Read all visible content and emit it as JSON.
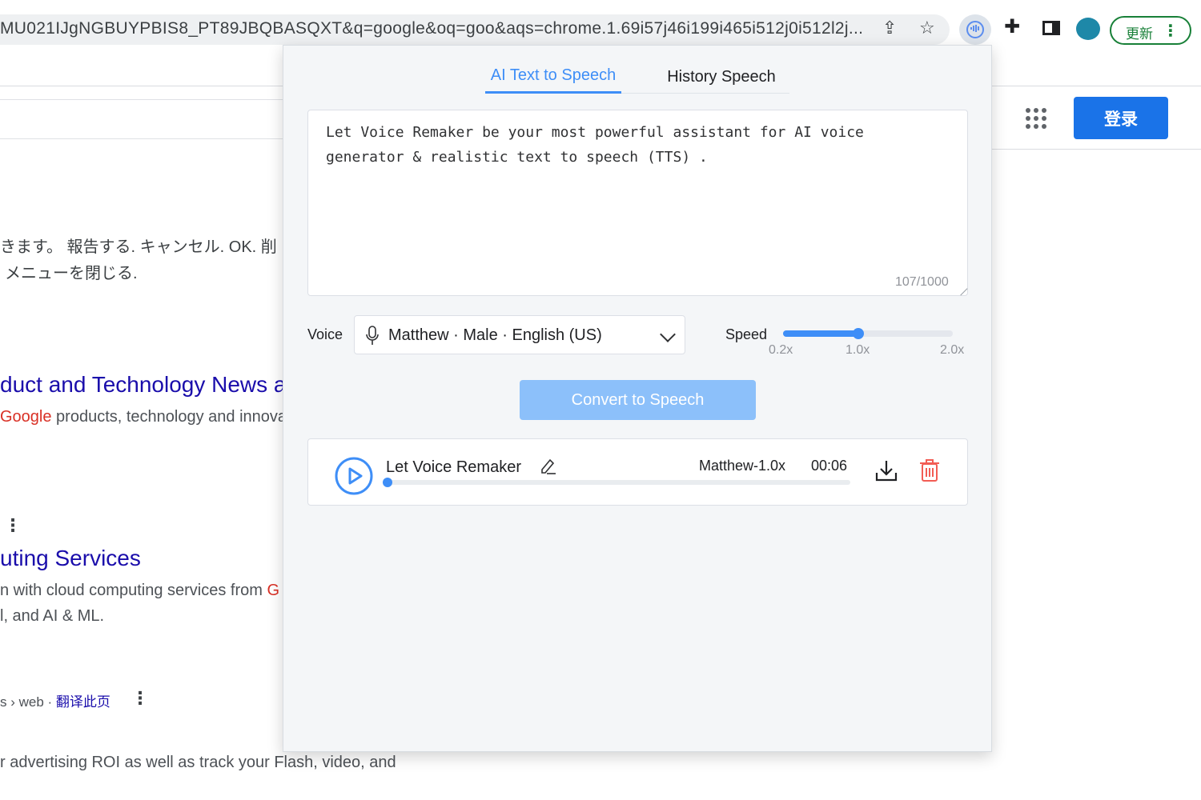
{
  "browser": {
    "url": "MU021IJgNGBUYPBIS8_PT89JBQBASQXT&q=google&oq=goo&aqs=chrome.1.69i57j46i199i465i512j0i512l2j...",
    "update_label": "更新",
    "icons": [
      "share-icon",
      "star-icon",
      "voice-remaker-extension-icon",
      "puzzle-icon",
      "side-panel-icon",
      "profile-avatar",
      "more-vert-icon"
    ]
  },
  "google_page": {
    "login_label": "登录",
    "snippet_ja_1": "きます。 報告する. キャンセル. OK. 削",
    "snippet_ja_2": "メニューを閉じる.",
    "result1_title": "duct and Technology News a",
    "result1_snippet_prefix": "Google",
    "result1_snippet_rest": " products, technology and innova",
    "result2_title": "uting Services",
    "result2_snippet_1_rest": "n with cloud computing services from ",
    "result2_snippet_1_red": "G",
    "result2_snippet_2": "l, and AI & ML.",
    "result3_breadcrumb": "s › web · ",
    "result3_translate": "翻译此页",
    "result3_snippet": "r advertising ROI as well as track your Flash, video, and"
  },
  "popup": {
    "tabs": [
      {
        "label": "AI Text to Speech",
        "active": true
      },
      {
        "label": "History Speech",
        "active": false
      }
    ],
    "text_input": "Let Voice Remaker be your most powerful assistant for AI voice generator & realistic text to speech (TTS) .",
    "char_count": "107/1000",
    "voice_label": "Voice",
    "voice_value": "Matthew · Male · English (US)",
    "speed_label": "Speed",
    "speed_ticks": [
      "0.2x",
      "1.0x",
      "2.0x"
    ],
    "speed_value": 1.0,
    "speed_min": 0.2,
    "speed_max": 2.0,
    "convert_label": "Convert to Speech",
    "history_item": {
      "title": "Let Voice Remaker",
      "voice_speed": "Matthew-1.0x",
      "duration": "00:06",
      "progress": 0
    },
    "colors": {
      "accent": "#3e8ef7",
      "convert_button": "#8cc0fa",
      "delete": "#f25c54"
    }
  }
}
